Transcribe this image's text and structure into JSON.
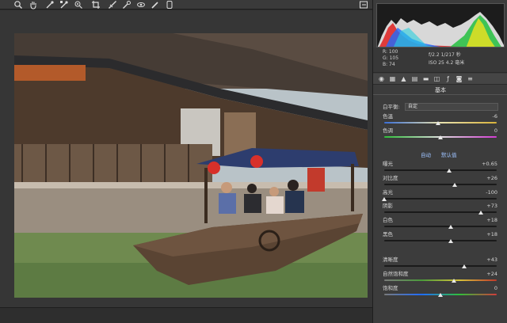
{
  "toolbar": {
    "icons": [
      "zoom-icon",
      "hand-icon",
      "eyedropper-icon",
      "color-sampler-icon",
      "target-adjust-icon",
      "crop-icon",
      "straighten-icon",
      "spot-removal-icon",
      "red-eye-icon",
      "brush-icon",
      "graduated-filter-icon"
    ]
  },
  "info": {
    "r": "R:  100",
    "g": "G:  105",
    "b": "B:   74",
    "aperture_shutter": "f/2.2   1/217 秒",
    "iso_focal": "ISO 25   4.2 毫米"
  },
  "panel": {
    "section_title": "基本",
    "white_balance_label": "白平衡:",
    "white_balance_value": "自定",
    "auto_label": "自动",
    "default_label": "默认值",
    "sliders": [
      {
        "label": "色温",
        "value": "-6",
        "position": 0.48
      },
      {
        "label": "色调",
        "value": "0",
        "position": 0.5
      },
      {
        "label": "曝光",
        "value": "+0.65",
        "position": 0.58
      },
      {
        "label": "对比度",
        "value": "+26",
        "position": 0.63
      },
      {
        "label": "高光",
        "value": "-100",
        "position": 0.0
      },
      {
        "label": "阴影",
        "value": "+73",
        "position": 0.86
      },
      {
        "label": "白色",
        "value": "+18",
        "position": 0.59
      },
      {
        "label": "黑色",
        "value": "+18",
        "position": 0.59
      },
      {
        "label": "清晰度",
        "value": "+43",
        "position": 0.71
      },
      {
        "label": "自然饱和度",
        "value": "+24",
        "position": 0.62
      },
      {
        "label": "饱和度",
        "value": "0",
        "position": 0.5
      }
    ]
  },
  "colors": {
    "panel_bg": "#3c3c3c",
    "canvas_bg": "#363636",
    "link_blue": "#9ec3ff"
  }
}
